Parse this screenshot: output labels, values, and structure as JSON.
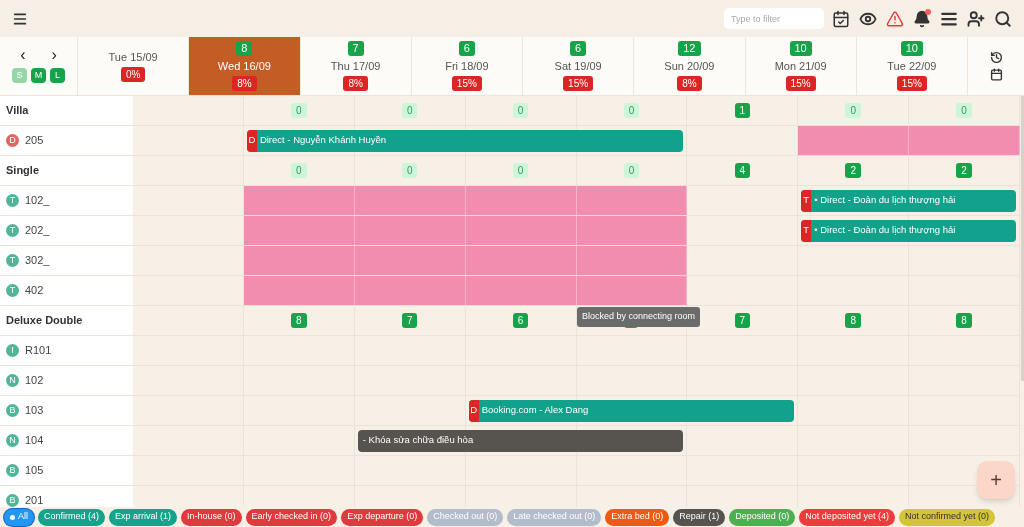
{
  "toolbar": {
    "search": {
      "placeholder": "Type to filter"
    },
    "icons": [
      {
        "kind": "calendar-check"
      },
      {
        "kind": "eye"
      },
      {
        "kind": "alert"
      },
      {
        "kind": "bell",
        "badge": true
      },
      {
        "kind": "list"
      },
      {
        "kind": "user-plus"
      },
      {
        "kind": "search"
      }
    ]
  },
  "nav": {
    "prev": "‹",
    "next": "›",
    "sizes": [
      {
        "label": "S",
        "selected": true
      },
      {
        "label": "M",
        "selected": false
      },
      {
        "label": "L",
        "selected": false
      }
    ]
  },
  "days": [
    {
      "date": "Tue 15/09",
      "percent": "0%",
      "selected": false
    },
    {
      "count": "8",
      "date": "Wed 16/09",
      "percent": "8%",
      "selected": true
    },
    {
      "count": "7",
      "date": "Thu 17/09",
      "percent": "8%",
      "selected": false
    },
    {
      "count": "6",
      "date": "Fri 18/09",
      "percent": "15%",
      "selected": false
    },
    {
      "count": "6",
      "date": "Sat 19/09",
      "percent": "15%",
      "selected": false
    },
    {
      "count": "12",
      "date": "Sun 20/09",
      "percent": "8%",
      "selected": false
    },
    {
      "count": "10",
      "date": "Mon 21/09",
      "percent": "15%",
      "selected": false
    },
    {
      "count": "10",
      "date": "Tue 22/09",
      "percent": "15%",
      "selected": false
    }
  ],
  "rows": [
    {
      "kind": "group",
      "name": "Villa",
      "cells": [
        {
          "kind": "blank"
        },
        {
          "kind": "count",
          "value": "0",
          "dim": true
        },
        {
          "kind": "count",
          "value": "0",
          "dim": true
        },
        {
          "kind": "count",
          "value": "0",
          "dim": true
        },
        {
          "kind": "count",
          "value": "0",
          "dim": true
        },
        {
          "kind": "count",
          "value": "1",
          "dim": false
        },
        {
          "kind": "count",
          "value": "0",
          "dim": true
        },
        {
          "kind": "count",
          "value": "0",
          "dim": true
        }
      ]
    },
    {
      "kind": "room",
      "name": "205",
      "tag": "D",
      "color": "#e06666",
      "cells": [
        {
          "kind": "empty"
        },
        {
          "kind": "booking",
          "tag": "D",
          "label": "Direct - Nguyễn Khánh Huyền"
        },
        {
          "kind": "continued"
        },
        {
          "kind": "continued"
        },
        {
          "kind": "continued"
        },
        {
          "kind": "empty"
        },
        {
          "kind": "blocked"
        },
        {
          "kind": "blocked"
        }
      ]
    },
    {
      "kind": "group",
      "name": "Single",
      "cells": [
        {
          "kind": "blank"
        },
        {
          "kind": "count",
          "value": "0",
          "dim": true
        },
        {
          "kind": "count",
          "value": "0",
          "dim": true
        },
        {
          "kind": "count",
          "value": "0",
          "dim": true
        },
        {
          "kind": "count",
          "value": "0",
          "dim": true
        },
        {
          "kind": "count",
          "value": "4",
          "dim": false
        },
        {
          "kind": "count",
          "value": "2",
          "dim": false
        },
        {
          "kind": "count",
          "value": "2",
          "dim": false
        }
      ]
    },
    {
      "kind": "room",
      "name": "102_",
      "tag": "T",
      "color": "#52b59a",
      "cells": [
        {
          "kind": "empty"
        },
        {
          "kind": "blocked"
        },
        {
          "kind": "blocked"
        },
        {
          "kind": "blocked"
        },
        {
          "kind": "blocked"
        },
        {
          "kind": "empty"
        },
        {
          "kind": "booking",
          "tag": "T",
          "label": "• Direct - Đoàn du lịch thượng hải"
        },
        {
          "kind": "continued"
        }
      ]
    },
    {
      "kind": "room",
      "name": "202_",
      "tag": "T",
      "color": "#52b59a",
      "cells": [
        {
          "kind": "empty"
        },
        {
          "kind": "blocked"
        },
        {
          "kind": "blocked"
        },
        {
          "kind": "blocked"
        },
        {
          "kind": "blocked"
        },
        {
          "kind": "empty"
        },
        {
          "kind": "booking",
          "tag": "T",
          "label": "• Direct - Đoàn du lịch thượng hải"
        },
        {
          "kind": "continued"
        }
      ]
    },
    {
      "kind": "room",
      "name": "302_",
      "tag": "T",
      "color": "#52b59a",
      "cells": [
        {
          "kind": "empty"
        },
        {
          "kind": "blocked"
        },
        {
          "kind": "blocked"
        },
        {
          "kind": "blocked"
        },
        {
          "kind": "blocked"
        },
        {
          "kind": "empty"
        },
        {
          "kind": "empty"
        },
        {
          "kind": "empty"
        }
      ]
    },
    {
      "kind": "room",
      "name": "402",
      "tag": "T",
      "color": "#52b59a",
      "cells": [
        {
          "kind": "empty"
        },
        {
          "kind": "blocked"
        },
        {
          "kind": "blocked"
        },
        {
          "kind": "blocked"
        },
        {
          "kind": "blocked"
        },
        {
          "kind": "empty"
        },
        {
          "kind": "empty"
        },
        {
          "kind": "empty"
        }
      ]
    },
    {
      "kind": "group",
      "name": "Deluxe Double",
      "cells": [
        {
          "kind": "blank"
        },
        {
          "kind": "count",
          "value": "8",
          "dim": false
        },
        {
          "kind": "count",
          "value": "7",
          "dim": false
        },
        {
          "kind": "count",
          "value": "6",
          "dim": false
        },
        {
          "kind": "covered"
        },
        {
          "kind": "count",
          "value": "7",
          "dim": false
        },
        {
          "kind": "count",
          "value": "8",
          "dim": false
        },
        {
          "kind": "count",
          "value": "8",
          "dim": false
        }
      ]
    },
    {
      "kind": "room",
      "name": "R101",
      "tag": "I",
      "color": "#52b59a"
    },
    {
      "kind": "room",
      "name": "102",
      "tag": "N",
      "color": "#52b59a"
    },
    {
      "kind": "room",
      "name": "103",
      "tag": "B",
      "color": "#52b59a",
      "cells": [
        {
          "kind": "empty"
        },
        {
          "kind": "empty"
        },
        {
          "kind": "empty"
        },
        {
          "kind": "booking",
          "tag": "D",
          "label": "Booking.com - Alex Dang"
        },
        {
          "kind": "continued"
        },
        {
          "kind": "continued"
        },
        {
          "kind": "empty"
        },
        {
          "kind": "empty"
        }
      ]
    },
    {
      "kind": "room",
      "name": "104",
      "tag": "N",
      "color": "#52b59a",
      "cells": [
        {
          "kind": "empty"
        },
        {
          "kind": "empty"
        },
        {
          "kind": "repair",
          "label": "- Khóa sửa chữa điều hòa"
        },
        {
          "kind": "continued"
        },
        {
          "kind": "continued"
        },
        {
          "kind": "empty"
        },
        {
          "kind": "empty"
        },
        {
          "kind": "empty"
        }
      ]
    },
    {
      "kind": "room",
      "name": "105",
      "tag": "B",
      "color": "#52b59a"
    },
    {
      "kind": "room",
      "name": "201",
      "tag": "B",
      "color": "#52b59a"
    }
  ],
  "tooltip": "Blocked by connecting room",
  "fab": "+",
  "filters": [
    {
      "label": "All",
      "color": "#2196f3",
      "selected": true
    },
    {
      "label": "Confirmed (4)",
      "color": "#14a38b",
      "selected": false
    },
    {
      "label": "Exp arrival (1)",
      "color": "#14a38b",
      "selected": false
    },
    {
      "label": "In-house (0)",
      "color": "#e0393e",
      "selected": false
    },
    {
      "label": "Early checked in (0)",
      "color": "#e0393e",
      "selected": false
    },
    {
      "label": "Exp departure (0)",
      "color": "#e0393e",
      "selected": false
    },
    {
      "label": "Checked out (0)",
      "color": "#b3bccb",
      "selected": false
    },
    {
      "label": "Late checked out (0)",
      "color": "#b3bccb",
      "selected": false
    },
    {
      "label": "Extra bed (0)",
      "color": "#ee5a12",
      "selected": false
    },
    {
      "label": "Repair (1)",
      "color": "#57534e",
      "selected": false
    },
    {
      "label": "Deposited (0)",
      "color": "#4caf50",
      "selected": false
    },
    {
      "label": "Not deposited yet (4)",
      "color": "#ef3b3b",
      "selected": false
    },
    {
      "label": "Not confirmed yet (0)",
      "color": "#d4c43a",
      "selected": false,
      "dark_text": true
    }
  ]
}
